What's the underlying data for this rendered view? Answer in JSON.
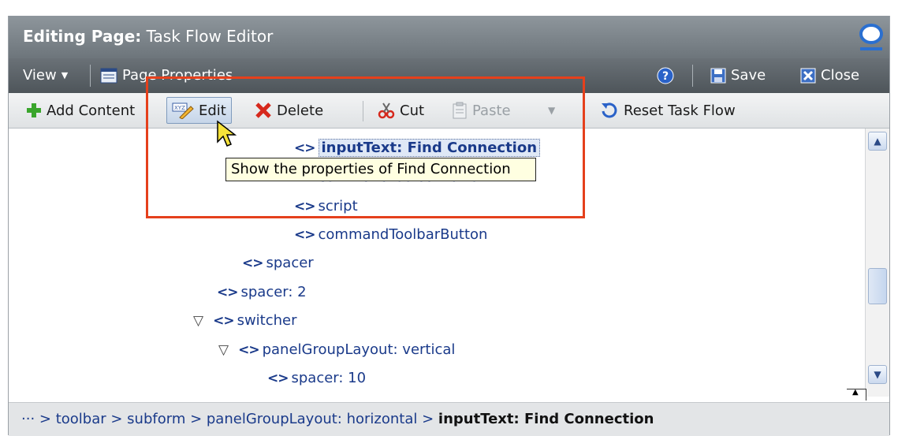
{
  "window": {
    "title_prefix": "Editing Page:",
    "title": "Task Flow Editor",
    "brand_icon": "oracle-logo"
  },
  "menubar": {
    "view_label": "View",
    "page_properties_label": "Page Properties",
    "save_label": "Save",
    "close_label": "Close"
  },
  "toolbar": {
    "add_content_label": "Add Content",
    "edit_label": "Edit",
    "delete_label": "Delete",
    "cut_label": "Cut",
    "paste_label": "Paste",
    "reset_task_flow_label": "Reset Task Flow"
  },
  "tooltip": {
    "text": "Show the properties of Find Connection"
  },
  "tree": {
    "nodes": [
      {
        "label": "inputText: Find Connection",
        "selected": true,
        "expanded": null
      },
      {
        "label": "commandToolbarButton",
        "selected": false,
        "expanded": null
      },
      {
        "label": "script",
        "selected": false,
        "expanded": null
      },
      {
        "label": "commandToolbarButton",
        "selected": false,
        "expanded": null
      },
      {
        "label": "spacer",
        "selected": false,
        "expanded": null
      },
      {
        "label": "spacer: 2",
        "selected": false,
        "expanded": null
      },
      {
        "label": "switcher",
        "selected": false,
        "expanded": true
      },
      {
        "label": "panelGroupLayout: vertical",
        "selected": false,
        "expanded": true
      },
      {
        "label": "spacer: 10",
        "selected": false,
        "expanded": null
      }
    ]
  },
  "breadcrumb": {
    "ellipsis": "···",
    "path": "> toolbar > subform > panelGroupLayout: horizontal >",
    "current": "inputText: Find Connection"
  },
  "colors": {
    "highlight_box": "#e5401c",
    "title_bar": "#7a8288",
    "node_text": "#1a3a8a"
  }
}
